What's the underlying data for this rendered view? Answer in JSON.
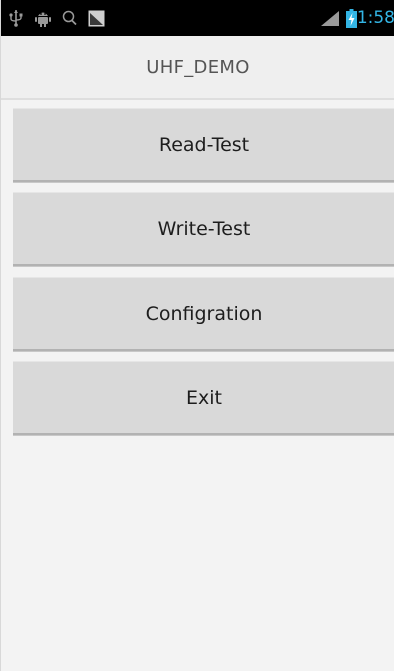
{
  "status_bar": {
    "time": "1:58",
    "time_color": "#33b5e5",
    "icons": [
      "usb-icon",
      "android-debug-icon",
      "search-icon",
      "screenshot-icon",
      "signal-icon",
      "battery-charging-icon"
    ]
  },
  "app": {
    "title": "UHF_DEMO"
  },
  "menu": {
    "read_test": "Read-Test",
    "write_test": "Write-Test",
    "configuration": "Configration",
    "exit": "Exit"
  },
  "colors": {
    "accent": "#33b5e5",
    "button_bg": "#d9d9d9",
    "background": "#f3f3f3"
  }
}
